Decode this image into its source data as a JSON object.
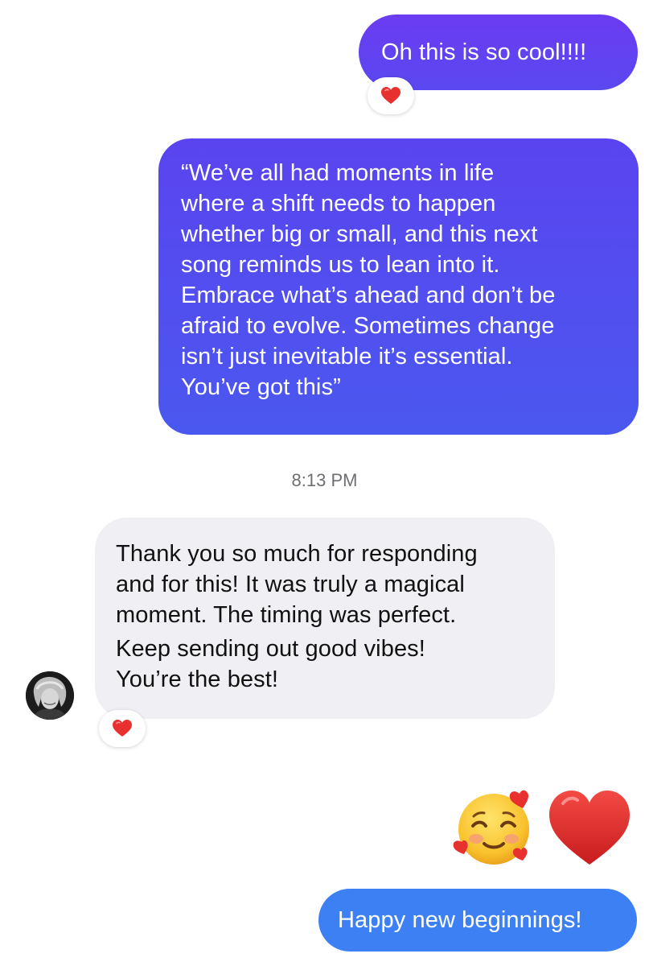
{
  "messages": [
    {
      "sender": "me",
      "text": "Oh this is so cool!!!!",
      "reaction": "heart-icon"
    },
    {
      "sender": "me",
      "lines": [
        "“We’ve all had moments in life",
        "where a shift needs to happen",
        "whether big or small, and this next",
        "song reminds us to lean into it.",
        "Embrace what’s ahead and don’t be",
        "afraid to evolve. Sometimes change",
        "isn’t just inevitable it’s essential.",
        "You’ve got this”"
      ]
    },
    {
      "timestamp": "8:13 PM"
    },
    {
      "sender": "them",
      "lines": [
        "Thank you so much for responding",
        "and for this! It was truly a magical",
        "moment. The timing was perfect.",
        "Keep sending out good vibes!",
        "You’re the best!"
      ],
      "reaction": "heart-icon"
    },
    {
      "sender": "me",
      "emoji": [
        "smiling-face-with-hearts-icon",
        "red-heart-icon"
      ]
    },
    {
      "sender": "me",
      "text": "Happy new beginnings!"
    }
  ],
  "colors": {
    "outgoing_gradient_top": "#6b3bf2",
    "outgoing_gradient_bottom": "#4a58ef",
    "outgoing_blue": "#3d80f4",
    "incoming_bg": "#efeff4",
    "reaction_heart": "#e8312f"
  }
}
